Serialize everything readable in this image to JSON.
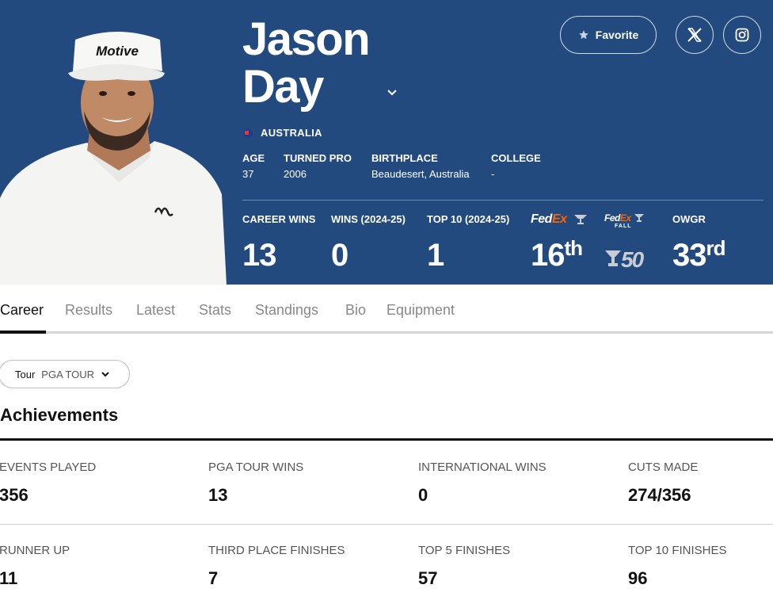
{
  "player": {
    "first_name": "Jason",
    "last_name": "Day",
    "country": "AUSTRALIA",
    "cap_logo": "Motive",
    "bio": [
      {
        "label": "AGE",
        "value": "37"
      },
      {
        "label": "TURNED PRO",
        "value": "2006"
      },
      {
        "label": "BIRTHPLACE",
        "value": "Beaudesert, Australia"
      },
      {
        "label": "COLLEGE",
        "value": "-"
      }
    ]
  },
  "actions": {
    "favorite_label": "Favorite",
    "icons": [
      "star-icon",
      "x-twitter-icon",
      "instagram-icon",
      "chevron-down-icon"
    ]
  },
  "stats": {
    "career_wins": {
      "label": "CAREER WINS",
      "value": "13"
    },
    "wins_season": {
      "label": "WINS (2024-25)",
      "value": "0"
    },
    "top10_season": {
      "label": "TOP 10 (2024-25)",
      "value": "1"
    },
    "fedex": {
      "logo_fed": "Fed",
      "logo_ex": "Ex",
      "value": "16",
      "suffix": "th"
    },
    "fedex_fall": {
      "logo_fed": "Fed",
      "logo_ex": "Ex",
      "sub": "FALL",
      "value": "50"
    },
    "owgr": {
      "label": "OWGR",
      "value": "33",
      "suffix": "rd"
    }
  },
  "tabs": [
    {
      "label": "Career",
      "active": true
    },
    {
      "label": "Results",
      "active": false
    },
    {
      "label": "Latest",
      "active": false
    },
    {
      "label": "Stats",
      "active": false
    },
    {
      "label": "Standings",
      "active": false
    },
    {
      "label": "Bio",
      "active": false
    },
    {
      "label": "Equipment",
      "active": false
    }
  ],
  "filter": {
    "label": "Tour",
    "value": "PGA TOUR"
  },
  "achievements": {
    "title": "Achievements",
    "items": [
      {
        "label": "EVENTS PLAYED",
        "value": "356"
      },
      {
        "label": "PGA TOUR WINS",
        "value": "13"
      },
      {
        "label": "INTERNATIONAL WINS",
        "value": "0"
      },
      {
        "label": "CUTS MADE",
        "value": "274/356"
      },
      {
        "label": "RUNNER UP",
        "value": "11"
      },
      {
        "label": "THIRD PLACE FINISHES",
        "value": "7"
      },
      {
        "label": "TOP 5 FINISHES",
        "value": "57"
      },
      {
        "label": "TOP 10 FINISHES",
        "value": "96"
      }
    ]
  },
  "colors": {
    "hero_bg": "#234a7e",
    "fedex_orange": "#ff6200",
    "text_dark": "#111111",
    "text_muted": "#888888"
  }
}
